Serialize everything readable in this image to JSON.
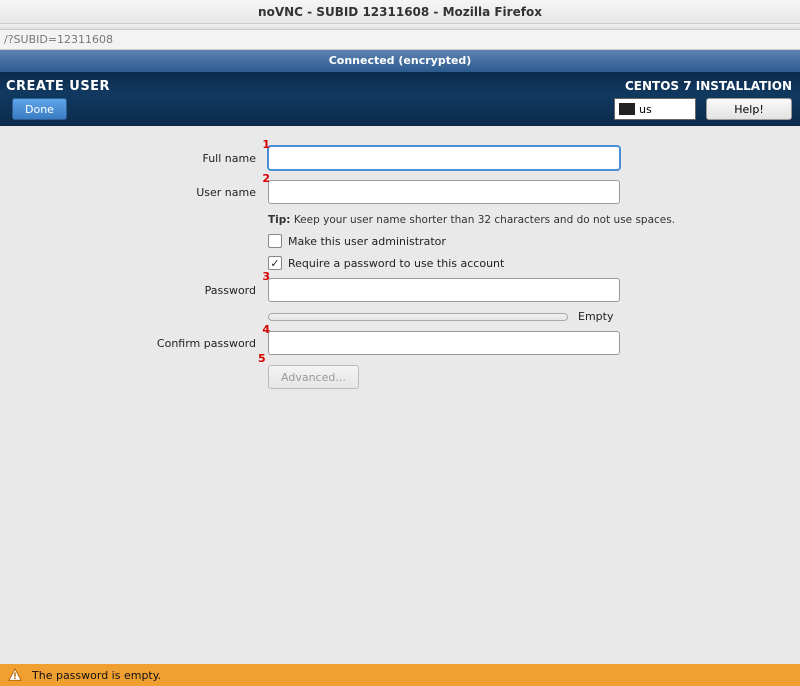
{
  "window": {
    "title": "noVNC - SUBID 12311608 - Mozilla Firefox"
  },
  "urlbar": {
    "text": "/?SUBID=12311608"
  },
  "vnc": {
    "status": "Connected (encrypted)"
  },
  "header": {
    "screen_title": "CREATE USER",
    "done": "Done",
    "install_title": "CENTOS 7 INSTALLATION",
    "keyboard_layout": "us",
    "help": "Help!"
  },
  "form": {
    "fullname_label": "Full name",
    "fullname_value": "",
    "username_label": "User name",
    "username_value": "",
    "tip_prefix": "Tip:",
    "tip_text": " Keep your user name shorter than 32 characters and do not use spaces.",
    "make_admin_label": "Make this user administrator",
    "make_admin_checked": false,
    "require_pwd_label": "Require a password to use this account",
    "require_pwd_checked": true,
    "password_label": "Password",
    "password_value": "",
    "strength_label": "Empty",
    "confirm_label": "Confirm password",
    "confirm_value": "",
    "advanced_label": "Advanced..."
  },
  "annotations": {
    "n1": "1",
    "n2": "2",
    "n3": "3",
    "n4": "4",
    "n5": "5"
  },
  "warning": {
    "text": "The password is empty."
  }
}
